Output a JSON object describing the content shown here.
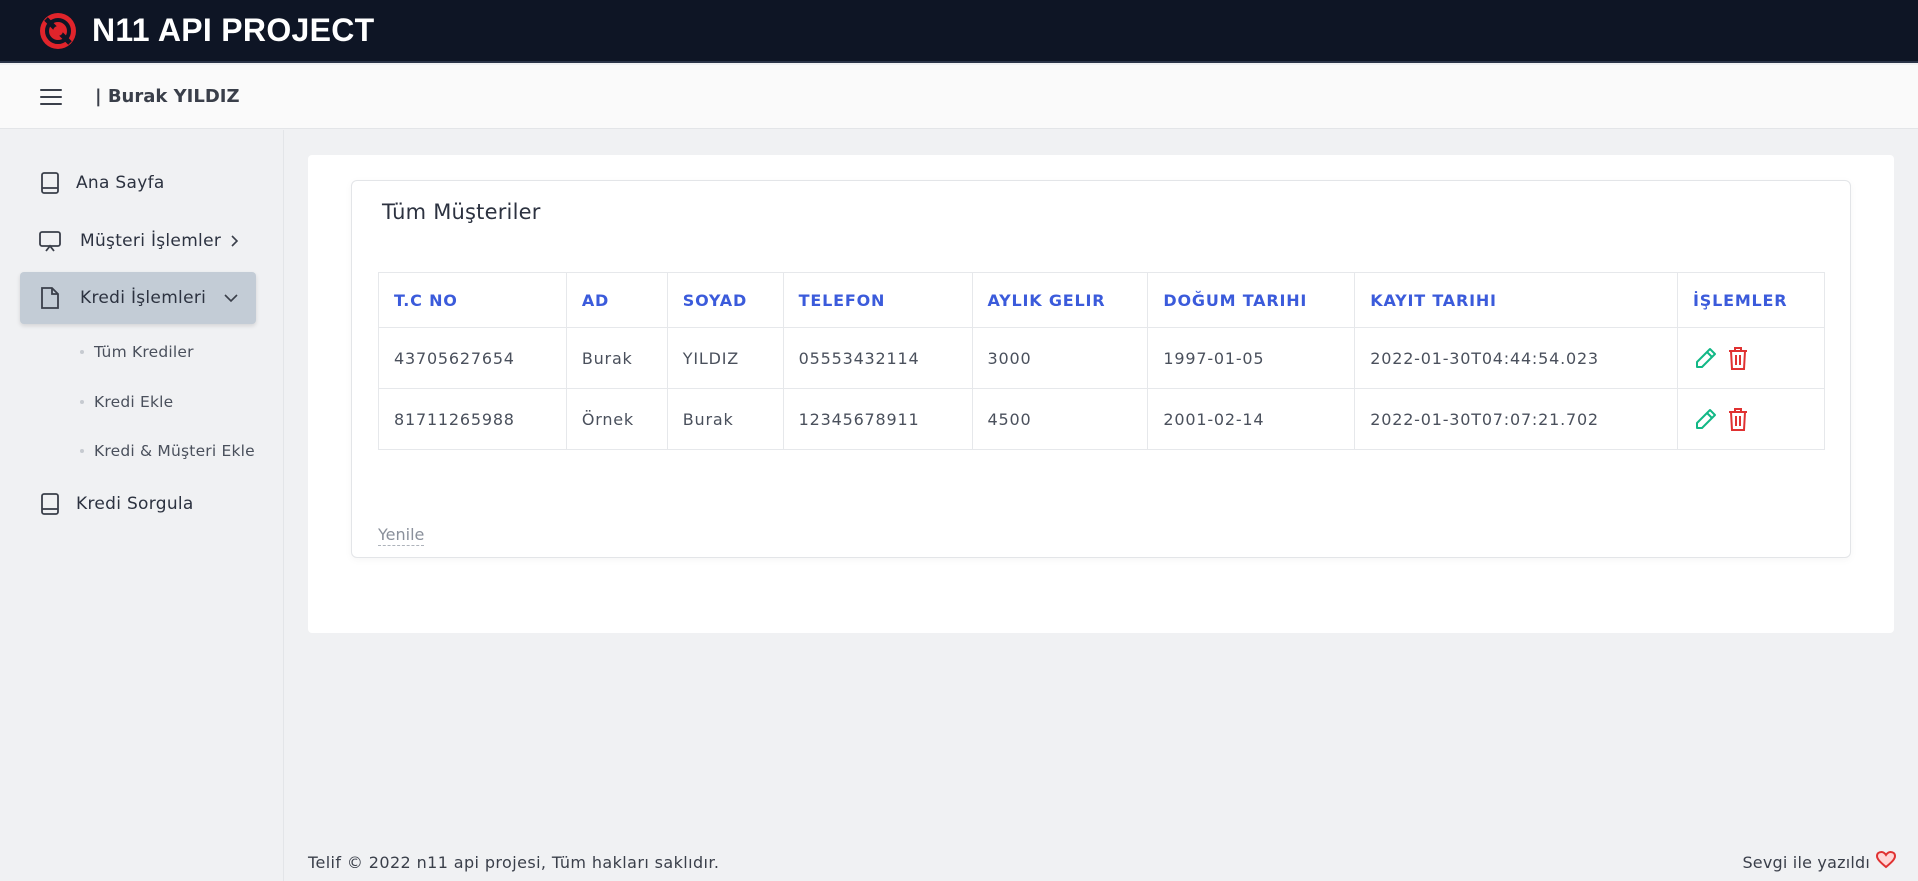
{
  "app": {
    "brand": "N11 API PROJECT",
    "user_label": "| Burak YILDIZ",
    "accent_color": "#3b5bdb",
    "active_nav_bg": "#c3ccd6"
  },
  "sidebar": {
    "items": [
      {
        "label": "Ana Sayfa",
        "icon": "book-icon"
      },
      {
        "label": "Müşteri İşlemler",
        "icon": "monitor-icon"
      },
      {
        "label": "Kredi İşlemleri",
        "icon": "document-icon",
        "expanded": true
      },
      {
        "label": "Kredi Sorgula",
        "icon": "book-icon"
      }
    ],
    "subitems": [
      {
        "label": "Tüm Krediler"
      },
      {
        "label": "Kredi Ekle"
      },
      {
        "label": "Kredi & Müşteri Ekle"
      }
    ]
  },
  "main": {
    "title": "Tüm Müşteriler",
    "columns": [
      "T.C NO",
      "AD",
      "SOYAD",
      "TELEFON",
      "AYLIK GELIR",
      "DOĞUM TARIHI",
      "KAYIT TARIHI",
      "İŞLEMLER"
    ],
    "rows": [
      [
        "43705627654",
        "Burak",
        "YILDIZ",
        "05553432114",
        "3000",
        "1997-01-05",
        "2022-01-30T04:44:54.023"
      ],
      [
        "81711265988",
        "Örnek",
        "Burak",
        "12345678911",
        "4500",
        "2001-02-14",
        "2022-01-30T07:07:21.702"
      ]
    ],
    "refresh_label": "Yenile"
  },
  "footer": {
    "copyright": "Telif © 2022 n11 api projesi, Tüm hakları saklıdır.",
    "made_with": "Sevgi ile yazıldı"
  }
}
